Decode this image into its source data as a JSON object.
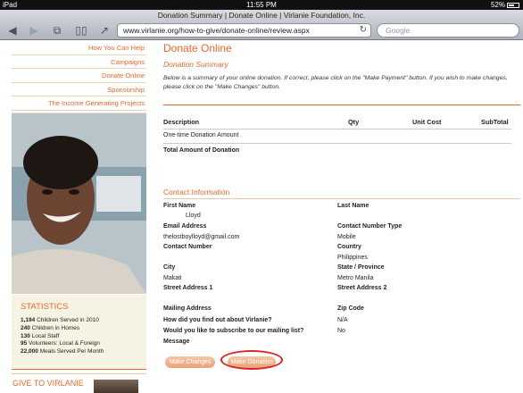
{
  "statusbar": {
    "device": "iPad",
    "time": "11:55 PM",
    "battery": "52%"
  },
  "browser": {
    "title": "Donation Summary | Donate Online | Virlanie Foundation, Inc.",
    "url": "www.virlanie.org/how-to-give/donate-online/review.aspx",
    "search_placeholder": "Google"
  },
  "sidebar": {
    "nav": [
      {
        "label": "How You Can Help"
      },
      {
        "label": "Campaigns"
      },
      {
        "label": "Donate Online"
      },
      {
        "label": "Sponsorship"
      },
      {
        "label": "The Income Generating Projects"
      }
    ],
    "stats_title": "STATISTICS",
    "stats": [
      {
        "num": "1,194",
        "text": "Children Served in 2010"
      },
      {
        "num": "240",
        "text": "Children in Homes"
      },
      {
        "num": "130",
        "text": "Local Staff"
      },
      {
        "num": "95",
        "text": "Volunteers: Local & Foreign"
      },
      {
        "num": "22,000",
        "text": "Meals Served Per Month"
      }
    ],
    "give_title": "GIVE TO VIRLANIE"
  },
  "main": {
    "title": "Donate Online",
    "subtitle": "Donation Summary",
    "intro": "Below is a summary of your online donation. If correct, please click on the \"Make Payment\" button. If you wish to make changes, please click on the \"Make Changes\" button.",
    "table": {
      "headers": {
        "description": "Description",
        "qty": "Qty",
        "unit_cost": "Unit Cost",
        "subtotal": "SubTotal"
      },
      "row": "One-time Donation Amount",
      "total": "Total Amount of Donation"
    },
    "contact_title": "Contact Information",
    "contact": {
      "first_name_label": "First Name",
      "first_name": "Lloyd",
      "last_name_label": "Last Name",
      "email_label": "Email Address",
      "email": "thelostboylloyd@gmail.com",
      "contact_type_label": "Contact Number Type",
      "contact_type": "Mobile",
      "contact_number_label": "Contact Number",
      "country_label": "Country",
      "country": "Philippines",
      "city_label": "City",
      "city": "Makati",
      "state_label": "State / Province",
      "state": "Metro Manila",
      "street1_label": "Street Address 1",
      "street2_label": "Street Address 2",
      "mailing_label": "Mailing Address",
      "zip_label": "Zip Code",
      "found_label": "How did you find out about Virlanie?",
      "found": "N/A",
      "subscribe_label": "Would you like to subscribe to our mailing list?",
      "subscribe": "No",
      "message_label": "Message"
    },
    "buttons": {
      "make_changes": "Make Changes",
      "make_donation": "Make Donation"
    }
  }
}
